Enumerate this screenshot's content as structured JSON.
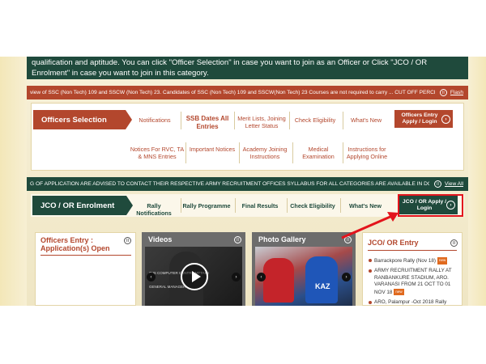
{
  "intro": {
    "text": "qualification and aptitude. You can click \"Officer Selection\" in case you want to join as an Officer or Click \"JCO / OR Enrolment\" in case you want to join in this category."
  },
  "ticker_top": {
    "text": "view of SSC (Non Tech) 109 and SSCW (Non Tech) 23. Candidates of SSC (Non Tech) 109 and SSCW(Non Tech) 23 Courses are not required to carry ...      CUT OFF PERCEI",
    "link": "Flash"
  },
  "officer": {
    "title": "Officers Selection",
    "row1": [
      "Notifications",
      "SSB Dates All Entries",
      "Merit Lists, Joining Letter Status",
      "Check Eligibility",
      "What's New"
    ],
    "row2": [
      "Notices For RVC, TA & MNS Entries",
      "Important Notices",
      "Academy Joining Instructions",
      "Medical Examination",
      "Instructions for Applying Online"
    ],
    "button": "Officers Entry Apply / Login"
  },
  "ticker_mid": {
    "text": "G OF APPLICATION ARE ADVISED TO CONTACT THEIR RESPECTIVE ARMY RECRUITMENT OFFICES      SYLLABUS FOR ALL CATEGORIES ARE AVAILABLE IN DOW",
    "link": "View All"
  },
  "jco": {
    "title": "JCO / OR Enrolment",
    "links": [
      "Rally Notifications",
      "Rally Programme",
      "Final Results",
      "Check Eligibility",
      "What's New"
    ],
    "button": "JCO / OR Apply / Login"
  },
  "cards": {
    "entry_title": "Officers Entry : Application(s) Open",
    "videos_title": "Videos",
    "video_caption": "OJS COMPUTER CENTRE MTTAMI",
    "video_sub": "GENERAL MANAGER",
    "photo_title": "Photo Gallery",
    "jersey": "KAZ",
    "jco_title": "JCO/ OR Entry",
    "news": [
      {
        "text": "Barrackpore Rally (Nov 18)",
        "badge": "new"
      },
      {
        "text": "ARMY RECRUITMENT RALLY AT RANBANKURE STADIUM, ARO. VARANASI FROM 21 OCT TO 01 NOV 18",
        "badge": "new"
      },
      {
        "text": "ARO, Palampur -Oct 2018 Rally",
        "badge": ""
      }
    ]
  },
  "colors": {
    "brick": "#b3472d",
    "green": "#1f4a3c",
    "highlight": "#e3141c"
  }
}
